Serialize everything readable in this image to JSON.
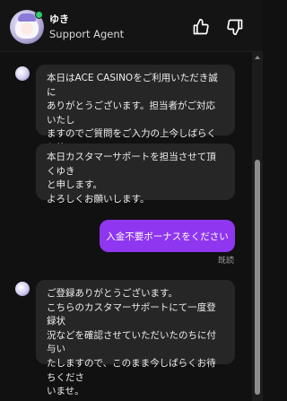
{
  "header": {
    "agent_name": "ゆき",
    "agent_role": "Support Agent"
  },
  "messages": [
    {
      "sender": "agent",
      "text": "本日はACE CASINOをご利用いただき誠に\nありがとうございます。担当者がご対応いたし\nますのでご質問をご入力の上今しばらくお待\nちくださいませ。"
    },
    {
      "sender": "agent",
      "text": "本日カスタマーサポートを担当させて頂くゆき\nと申します。\nよろしくお願いします。"
    },
    {
      "sender": "user",
      "text": "入金不要ボーナスをください",
      "status": "既読"
    },
    {
      "sender": "agent",
      "text": "ご登録ありがとうございます。\nこちらのカスタマーサポートにて一度登録状\n況などを確認させていただいたのちに付与い\nたしますので、このまま今しばらくお待ちくださ\nいませ。"
    }
  ],
  "colors": {
    "background": "#111111",
    "agent_bubble": "#262626",
    "user_bubble": "#8f36f0",
    "online": "#2ecc71"
  }
}
